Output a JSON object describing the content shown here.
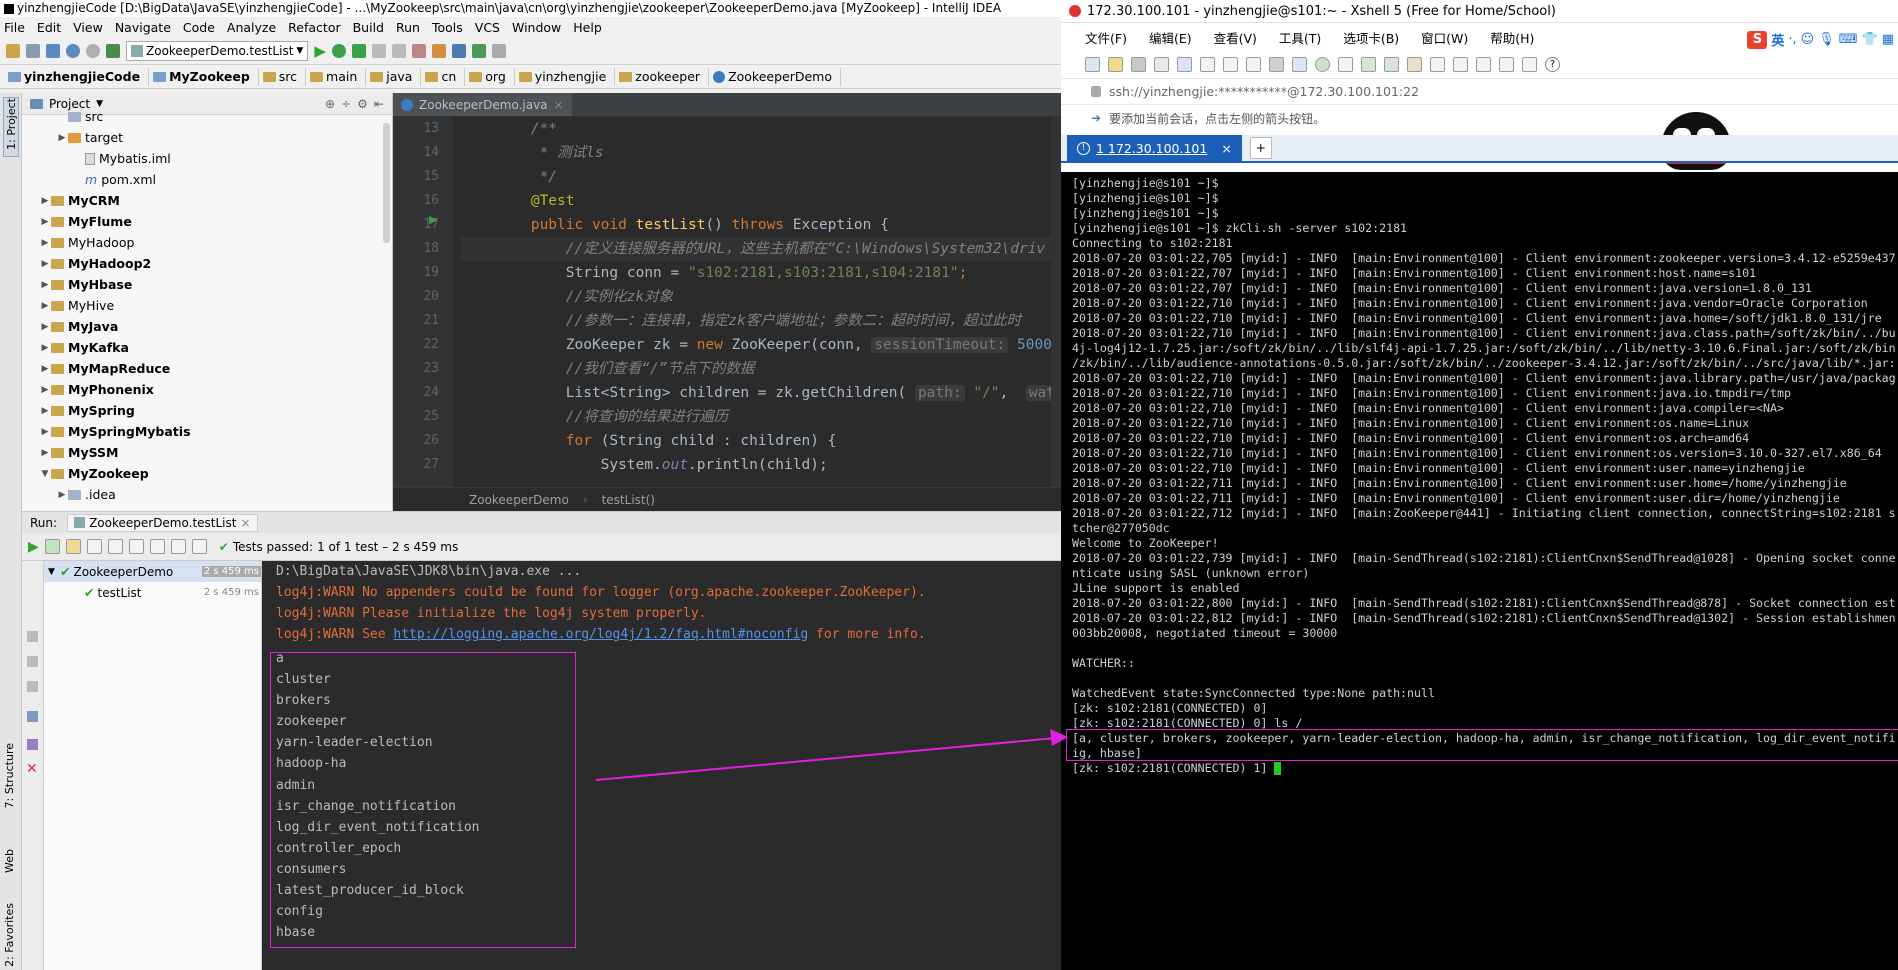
{
  "ide": {
    "window_title": "yinzhengjieCode [D:\\BigData\\JavaSE\\yinzhengjieCode] - ...\\MyZookeep\\src\\main\\java\\cn\\org\\yinzhengjie\\zookeeper\\ZookeeperDemo.java [MyZookeep] - IntelliJ IDEA",
    "menu": [
      "File",
      "Edit",
      "View",
      "Navigate",
      "Code",
      "Analyze",
      "Refactor",
      "Build",
      "Run",
      "Tools",
      "VCS",
      "Window",
      "Help"
    ],
    "run_config": "ZookeeperDemo.testList",
    "breadcrumbs": [
      "yinzhengjieCode",
      "MyZookeep",
      "src",
      "main",
      "java",
      "cn",
      "org",
      "yinzhengjie",
      "zookeeper",
      "ZookeeperDemo"
    ],
    "left_strip": [
      "1: Project",
      "7: Structure",
      "Web",
      "2: Favorites"
    ],
    "project_panel_title": "Project",
    "tree": [
      {
        "label": "src",
        "indent": 2,
        "arrow": "",
        "type": "folder",
        "bold": false
      },
      {
        "label": "target",
        "indent": 2,
        "arrow": "▶",
        "type": "folder-orange",
        "bold": false
      },
      {
        "label": "Mybatis.iml",
        "indent": 3,
        "arrow": "",
        "type": "file",
        "bold": false
      },
      {
        "label": "pom.xml",
        "indent": 3,
        "arrow": "",
        "type": "maven",
        "bold": false
      },
      {
        "label": "MyCRM",
        "indent": 1,
        "arrow": "▶",
        "type": "module",
        "bold": true
      },
      {
        "label": "MyFlume",
        "indent": 1,
        "arrow": "▶",
        "type": "module",
        "bold": true
      },
      {
        "label": "MyHadoop",
        "indent": 1,
        "arrow": "▶",
        "type": "module",
        "bold": false
      },
      {
        "label": "MyHadoop2",
        "indent": 1,
        "arrow": "▶",
        "type": "module",
        "bold": true
      },
      {
        "label": "MyHbase",
        "indent": 1,
        "arrow": "▶",
        "type": "module",
        "bold": true
      },
      {
        "label": "MyHive",
        "indent": 1,
        "arrow": "▶",
        "type": "module",
        "bold": false
      },
      {
        "label": "MyJava",
        "indent": 1,
        "arrow": "▶",
        "type": "module",
        "bold": true
      },
      {
        "label": "MyKafka",
        "indent": 1,
        "arrow": "▶",
        "type": "module",
        "bold": true
      },
      {
        "label": "MyMapReduce",
        "indent": 1,
        "arrow": "▶",
        "type": "module",
        "bold": true
      },
      {
        "label": "MyPhonenix",
        "indent": 1,
        "arrow": "▶",
        "type": "module",
        "bold": true
      },
      {
        "label": "MySpring",
        "indent": 1,
        "arrow": "▶",
        "type": "module",
        "bold": true
      },
      {
        "label": "MySpringMybatis",
        "indent": 1,
        "arrow": "▶",
        "type": "module",
        "bold": true
      },
      {
        "label": "MySSM",
        "indent": 1,
        "arrow": "▶",
        "type": "module",
        "bold": true
      },
      {
        "label": "MyZookeep",
        "indent": 1,
        "arrow": "▼",
        "type": "module",
        "bold": true
      },
      {
        "label": ".idea",
        "indent": 2,
        "arrow": "▶",
        "type": "folder",
        "bold": false
      }
    ],
    "editor_tab": "ZookeeperDemo.java",
    "line_numbers": [
      "13",
      "14",
      "15",
      "16",
      "17",
      "18",
      "19",
      "20",
      "21",
      "22",
      "23",
      "24",
      "25",
      "26",
      "27"
    ],
    "code": [
      {
        "t": "cmt",
        "s": "        /**"
      },
      {
        "t": "cmt",
        "s": "         * 测试ls"
      },
      {
        "t": "cmt",
        "s": "         */"
      },
      {
        "t": "ann",
        "s": "        @Test"
      },
      {
        "t": "sig",
        "a": "        ",
        "b": "public void ",
        "c": "testList",
        "d": "() ",
        "e": "throws ",
        "f": "Exception {"
      },
      {
        "t": "cmt2",
        "s": "            //定义连接服务器的URL，这些主机都在“C:\\Windows\\System32\\driv"
      },
      {
        "t": "strl",
        "a": "            String conn = ",
        "b": "\"s102:2181,s103:2181,s104:2181\"",
        "c": ";"
      },
      {
        "t": "cmt2",
        "s": "            //实例化zk对象"
      },
      {
        "t": "cmt2",
        "s": "            //参数一：连接串，指定zk客户端地址；参数二：超时时间，超过此时"
      },
      {
        "t": "zk",
        "a": "            ZooKeeper zk = ",
        "b": "new ",
        "c": "ZooKeeper(conn, ",
        "h": "sessionTimeout:",
        "n": " 5000",
        "d": ",  w"
      },
      {
        "t": "cmt2",
        "s": "            //我们查看“/”节点下的数据"
      },
      {
        "t": "gc",
        "a": "            List<String> children = zk.getChildren( ",
        "h": "path:",
        "b": " \"/\"",
        "c": ",  ",
        "h2": "watcher"
      },
      {
        "t": "cmt2",
        "s": "            //将查询的结果进行遍历"
      },
      {
        "t": "for",
        "a": "            ",
        "b": "for ",
        "c": "(String child : children) {"
      },
      {
        "t": "pr",
        "a": "                System.",
        "b": "out",
        "c": ".println(child);"
      }
    ],
    "editor_crumbs": [
      "ZookeeperDemo",
      "testList()"
    ],
    "run_label": "Run:",
    "run_tab": "ZookeeperDemo.testList",
    "tests_passed": "Tests passed:",
    "tests_summary": " 1 of 1 test – 2 s 459 ms",
    "run_tree": [
      {
        "label": "ZookeeperDemo",
        "time": "2 s 459 ms"
      },
      {
        "label": "testList",
        "time": "2 s 459 ms"
      }
    ],
    "console": {
      "cmd": "D:\\BigData\\JavaSE\\JDK8\\bin\\java.exe ...",
      "warn1": "log4j:WARN No appenders could be found for logger (org.apache.zookeeper.ZooKeeper).",
      "warn2": "log4j:WARN Please initialize the log4j system properly.",
      "warn3a": "log4j:WARN See ",
      "warn3link": "http://logging.apache.org/log4j/1.2/faq.html#noconfig",
      "warn3b": " for more info.",
      "children": [
        "a",
        "cluster",
        "brokers",
        "zookeeper",
        "yarn-leader-election",
        "hadoop-ha",
        "admin",
        "isr_change_notification",
        "log_dir_event_notification",
        "controller_epoch",
        "consumers",
        "latest_producer_id_block",
        "config",
        "hbase"
      ]
    }
  },
  "xshell": {
    "title": "172.30.100.101 - yinzhengjie@s101:~ - Xshell 5 (Free for Home/School)",
    "menu": [
      "文件(F)",
      "编辑(E)",
      "查看(V)",
      "工具(T)",
      "选项卡(B)",
      "窗口(W)",
      "帮助(H)"
    ],
    "address": "ssh://yinzhengjie:***********@172.30.100.101:22",
    "hint": "要添加当前会话，点击左侧的箭头按钮。",
    "tab": "1 172.30.100.101",
    "ime": "英",
    "lines": [
      "[yinzhengjie@s101 ~]$",
      "[yinzhengjie@s101 ~]$",
      "[yinzhengjie@s101 ~]$",
      "[yinzhengjie@s101 ~]$ zkCli.sh -server s102:2181",
      "Connecting to s102:2181",
      "2018-07-20 03:01:22,705 [myid:] - INFO  [main:Environment@100] - Client environment:zookeeper.version=3.4.12-e5259e437",
      "2018-07-20 03:01:22,707 [myid:] - INFO  [main:Environment@100] - Client environment:host.name=s101",
      "2018-07-20 03:01:22,707 [myid:] - INFO  [main:Environment@100] - Client environment:java.version=1.8.0_131",
      "2018-07-20 03:01:22,710 [myid:] - INFO  [main:Environment@100] - Client environment:java.vendor=Oracle Corporation",
      "2018-07-20 03:01:22,710 [myid:] - INFO  [main:Environment@100] - Client environment:java.home=/soft/jdk1.8.0_131/jre",
      "2018-07-20 03:01:22,710 [myid:] - INFO  [main:Environment@100] - Client environment:java.class.path=/soft/zk/bin/../bu",
      "4j-log4j12-1.7.25.jar:/soft/zk/bin/../lib/slf4j-api-1.7.25.jar:/soft/zk/bin/../lib/netty-3.10.6.Final.jar:/soft/zk/bin",
      "/zk/bin/../lib/audience-annotations-0.5.0.jar:/soft/zk/bin/../zookeeper-3.4.12.jar:/soft/zk/bin/../src/java/lib/*.jar:",
      "2018-07-20 03:01:22,710 [myid:] - INFO  [main:Environment@100] - Client environment:java.library.path=/usr/java/packag",
      "2018-07-20 03:01:22,710 [myid:] - INFO  [main:Environment@100] - Client environment:java.io.tmpdir=/tmp",
      "2018-07-20 03:01:22,710 [myid:] - INFO  [main:Environment@100] - Client environment:java.compiler=<NA>",
      "2018-07-20 03:01:22,710 [myid:] - INFO  [main:Environment@100] - Client environment:os.name=Linux",
      "2018-07-20 03:01:22,710 [myid:] - INFO  [main:Environment@100] - Client environment:os.arch=amd64",
      "2018-07-20 03:01:22,710 [myid:] - INFO  [main:Environment@100] - Client environment:os.version=3.10.0-327.el7.x86_64",
      "2018-07-20 03:01:22,710 [myid:] - INFO  [main:Environment@100] - Client environment:user.name=yinzhengjie",
      "2018-07-20 03:01:22,711 [myid:] - INFO  [main:Environment@100] - Client environment:user.home=/home/yinzhengjie",
      "2018-07-20 03:01:22,711 [myid:] - INFO  [main:Environment@100] - Client environment:user.dir=/home/yinzhengjie",
      "2018-07-20 03:01:22,712 [myid:] - INFO  [main:ZooKeeper@441] - Initiating client connection, connectString=s102:2181 s",
      "tcher@277050dc",
      "Welcome to ZooKeeper!",
      "2018-07-20 03:01:22,739 [myid:] - INFO  [main-SendThread(s102:2181):ClientCnxn$SendThread@1028] - Opening socket conne",
      "nticate using SASL (unknown error)",
      "JLine support is enabled",
      "2018-07-20 03:01:22,800 [myid:] - INFO  [main-SendThread(s102:2181):ClientCnxn$SendThread@878] - Socket connection est",
      "2018-07-20 03:01:22,812 [myid:] - INFO  [main-SendThread(s102:2181):ClientCnxn$SendThread@1302] - Session establishmen",
      "003bb20008, negotiated timeout = 30000",
      "",
      "WATCHER::",
      "",
      "WatchedEvent state:SyncConnected type:None path:null",
      "[zk: s102:2181(CONNECTED) 0]",
      "[zk: s102:2181(CONNECTED) 0] ls /",
      "[a, cluster, brokers, zookeeper, yarn-leader-election, hadoop-ha, admin, isr_change_notification, log_dir_event_notifi",
      "ig, hbase]"
    ],
    "prompt": "[zk: s102:2181(CONNECTED) 1] "
  },
  "colors": {
    "highlight": "#e020e0",
    "xshell_blue": "#1c5fb8",
    "ide_dark": "#2b2b2b",
    "warn": "#e06c3c"
  }
}
